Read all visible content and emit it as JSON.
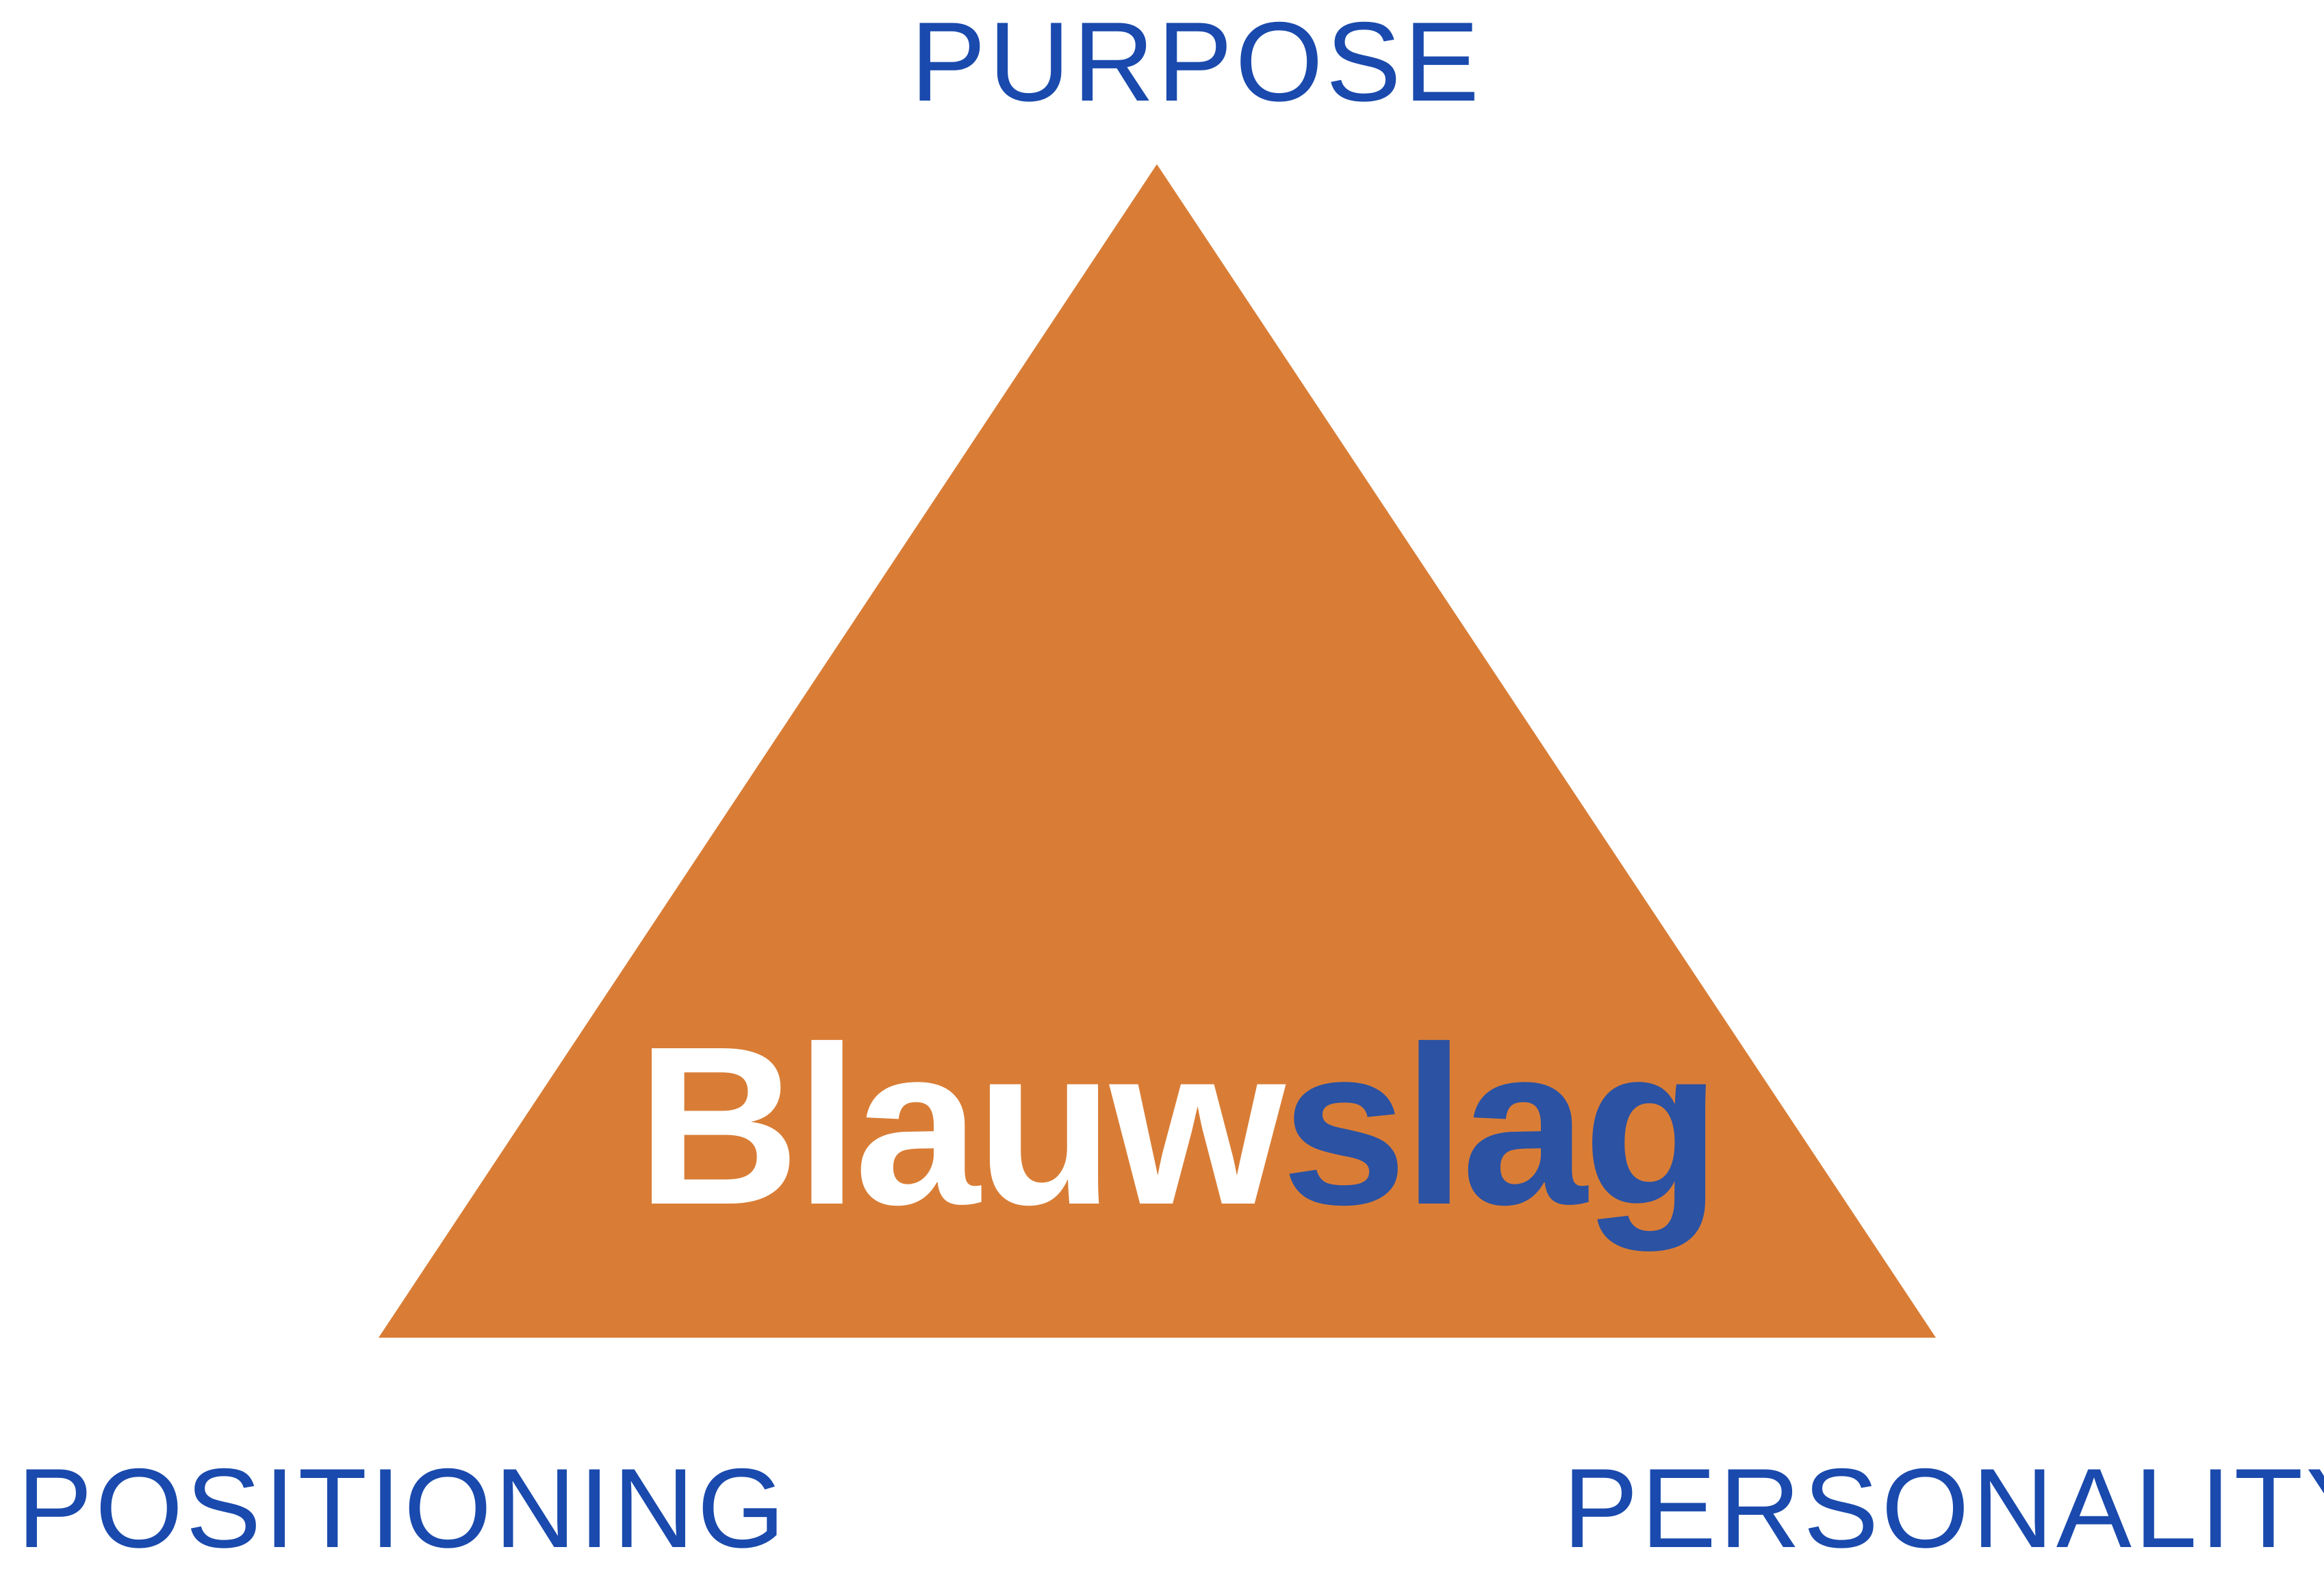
{
  "labels": {
    "top": "PURPOSE",
    "bottom_left": "POSITIONING",
    "bottom_right": "PERSONALITY"
  },
  "center": {
    "wordmark_part_1": "Blauw",
    "wordmark_part_2": "slag"
  },
  "colors": {
    "label_text": "#1a4aad",
    "triangle_fill": "#d97d36",
    "wordmark_part_1": "#ffffff",
    "wordmark_part_2": "#2b52a3",
    "background": "#ffffff"
  }
}
